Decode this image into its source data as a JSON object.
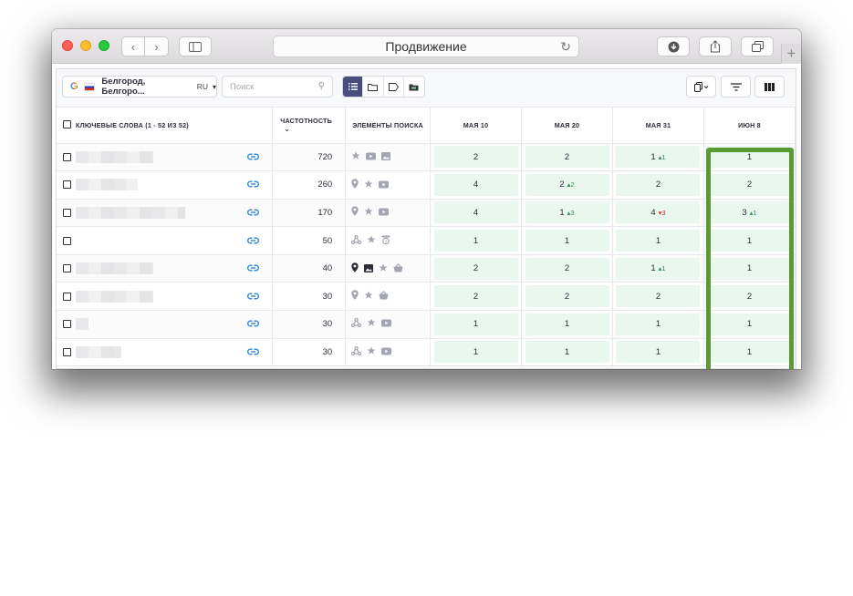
{
  "browser": {
    "address_title": "Продвижение",
    "nav_back": "‹",
    "nav_forward": "›",
    "new_tab": "+"
  },
  "toolbar": {
    "region_label": "Белгород, Белгоро...",
    "region_lang": "RU",
    "search_placeholder": "Поиск",
    "view_modes": [
      "list-icon",
      "folder-icon",
      "tag-icon",
      "folder-group-icon"
    ],
    "active_view": "list-icon"
  },
  "table": {
    "headers": {
      "keywords": "Ключевые слова (1 - 52 из 52)",
      "frequency": "Частотность",
      "elements": "Элементы поиска",
      "dates": [
        "Мая 10",
        "Мая 20",
        "Мая 31",
        "Июн 8"
      ]
    },
    "rows": [
      {
        "kw_width": 85,
        "freq": "720",
        "elements": [
          {
            "icon": "star-icon"
          },
          {
            "icon": "video-icon"
          },
          {
            "icon": "image-icon"
          }
        ],
        "pos": [
          {
            "v": "2"
          },
          {
            "v": "2"
          },
          {
            "v": "1",
            "d": "1",
            "dir": "up"
          },
          {
            "v": "1"
          }
        ]
      },
      {
        "kw_width": 68,
        "freq": "260",
        "elements": [
          {
            "icon": "location-pin-icon"
          },
          {
            "icon": "star-icon"
          },
          {
            "icon": "video-icon"
          }
        ],
        "pos": [
          {
            "v": "4"
          },
          {
            "v": "2",
            "d": "2",
            "dir": "up"
          },
          {
            "v": "2"
          },
          {
            "v": "2"
          }
        ]
      },
      {
        "kw_width": 120,
        "freq": "170",
        "elements": [
          {
            "icon": "location-pin-icon"
          },
          {
            "icon": "star-icon"
          },
          {
            "icon": "video-icon"
          }
        ],
        "pos": [
          {
            "v": "4"
          },
          {
            "v": "1",
            "d": "3",
            "dir": "up"
          },
          {
            "v": "4",
            "d": "3",
            "dir": "down"
          },
          {
            "v": "3",
            "d": "1",
            "dir": "up"
          }
        ]
      },
      {
        "kw_width": 0,
        "freq": "50",
        "elements": [
          {
            "icon": "sitelinks-icon"
          },
          {
            "icon": "star-icon"
          },
          {
            "icon": "price-icon"
          }
        ],
        "pos": [
          {
            "v": "1"
          },
          {
            "v": "1"
          },
          {
            "v": "1"
          },
          {
            "v": "1"
          }
        ]
      },
      {
        "kw_width": 85,
        "freq": "40",
        "elements": [
          {
            "icon": "location-pin-icon",
            "dark": true
          },
          {
            "icon": "image-icon",
            "dark": true
          },
          {
            "icon": "star-icon"
          },
          {
            "icon": "basket-icon"
          }
        ],
        "pos": [
          {
            "v": "2"
          },
          {
            "v": "2"
          },
          {
            "v": "1",
            "d": "1",
            "dir": "up"
          },
          {
            "v": "1"
          }
        ]
      },
      {
        "kw_width": 85,
        "freq": "30",
        "elements": [
          {
            "icon": "location-pin-icon"
          },
          {
            "icon": "star-icon"
          },
          {
            "icon": "basket-icon"
          }
        ],
        "pos": [
          {
            "v": "2"
          },
          {
            "v": "2"
          },
          {
            "v": "2"
          },
          {
            "v": "2"
          }
        ]
      },
      {
        "kw_width": 14,
        "freq": "30",
        "elements": [
          {
            "icon": "sitelinks-icon"
          },
          {
            "icon": "star-icon"
          },
          {
            "icon": "video-icon"
          }
        ],
        "pos": [
          {
            "v": "1"
          },
          {
            "v": "1"
          },
          {
            "v": "1"
          },
          {
            "v": "1"
          }
        ]
      },
      {
        "kw_width": 50,
        "freq": "30",
        "elements": [
          {
            "icon": "sitelinks-icon"
          },
          {
            "icon": "star-icon"
          },
          {
            "icon": "video-icon"
          }
        ],
        "pos": [
          {
            "v": "1"
          },
          {
            "v": "1"
          },
          {
            "v": "1"
          },
          {
            "v": "1"
          }
        ]
      }
    ]
  },
  "colors": {
    "accent": "#4a4e7e",
    "position_bg": "#e9f7ee",
    "highlight": "#5a9a32",
    "link": "#3a8dd8",
    "delta_up": "#2d8a4e",
    "delta_down": "#d0312d"
  }
}
